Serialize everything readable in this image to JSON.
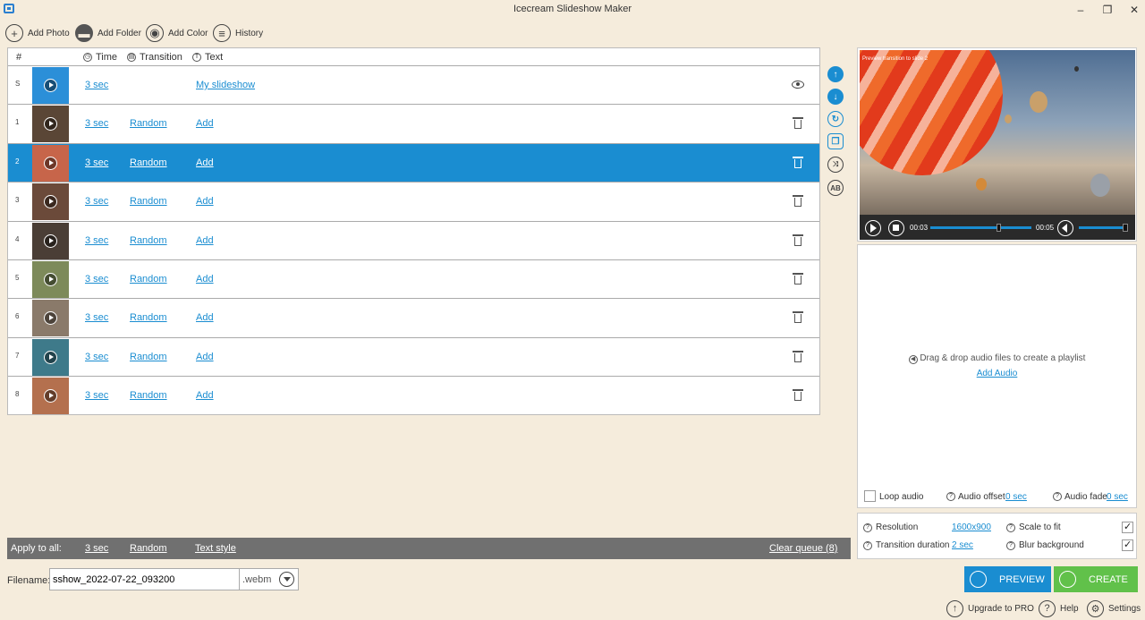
{
  "window": {
    "title": "Icecream Slideshow Maker",
    "min": "–",
    "restore": "❐",
    "close": "✕"
  },
  "toolbar": {
    "add_photo": "Add Photo",
    "add_folder": "Add Folder",
    "add_color": "Add Color",
    "history": "History"
  },
  "table": {
    "headers": {
      "num": "#",
      "time": "Time",
      "transition": "Transition",
      "text": "Text"
    },
    "rows": [
      {
        "num": "S",
        "time": "3 sec",
        "transition": "",
        "text": "My slideshow",
        "action": "eye",
        "thumb_color": "#2b8fd8",
        "selected": false
      },
      {
        "num": "1",
        "time": "3 sec",
        "transition": "Random",
        "text": "Add",
        "action": "trash",
        "thumb_color": "#5a4636",
        "selected": false
      },
      {
        "num": "2",
        "time": "3 sec",
        "transition": "Random",
        "text": "Add",
        "action": "trash",
        "thumb_color": "#c7654a",
        "selected": true
      },
      {
        "num": "3",
        "time": "3 sec",
        "transition": "Random",
        "text": "Add",
        "action": "trash",
        "thumb_color": "#6b4a3a",
        "selected": false
      },
      {
        "num": "4",
        "time": "3 sec",
        "transition": "Random",
        "text": "Add",
        "action": "trash",
        "thumb_color": "#4a3e36",
        "selected": false
      },
      {
        "num": "5",
        "time": "3 sec",
        "transition": "Random",
        "text": "Add",
        "action": "trash",
        "thumb_color": "#7d8a5a",
        "selected": false
      },
      {
        "num": "6",
        "time": "3 sec",
        "transition": "Random",
        "text": "Add",
        "action": "trash",
        "thumb_color": "#8a7a6a",
        "selected": false
      },
      {
        "num": "7",
        "time": "3 sec",
        "transition": "Random",
        "text": "Add",
        "action": "trash",
        "thumb_color": "#3e7a8a",
        "selected": false
      },
      {
        "num": "8",
        "time": "3 sec",
        "transition": "Random",
        "text": "Add",
        "action": "trash",
        "thumb_color": "#b4704e",
        "selected": false
      }
    ]
  },
  "apply_bar": {
    "label": "Apply to all:",
    "time": "3 sec",
    "transition": "Random",
    "text_style": "Text style",
    "clear_queue": "Clear queue (8)"
  },
  "filename": {
    "label": "Filename:",
    "value": "sshow_2022-07-22_093200",
    "ext": ".webm"
  },
  "preview": {
    "caption": "Preview transition to slide 2",
    "current_time": "00:03",
    "total_time": "00:05"
  },
  "audio": {
    "hint": "Drag & drop audio files to create a playlist",
    "add_audio": "Add Audio",
    "loop_label": "Loop audio",
    "offset_label": "Audio offset",
    "offset_value": "0 sec",
    "fade_label": "Audio fade",
    "fade_value": "0 sec"
  },
  "settings": {
    "resolution_label": "Resolution",
    "resolution_value": "1600x900",
    "transition_duration_label": "Transition duration",
    "transition_duration_value": "2 sec",
    "scale_label": "Scale to fit",
    "blur_label": "Blur background"
  },
  "actions": {
    "preview": "PREVIEW",
    "create": "CREATE"
  },
  "footer": {
    "upgrade": "Upgrade to PRO",
    "help": "Help",
    "settings": "Settings"
  },
  "colors": {
    "accent": "#1a8dd1",
    "create": "#61c14a",
    "background": "#f5ecdc",
    "apply_bar": "#707070"
  }
}
